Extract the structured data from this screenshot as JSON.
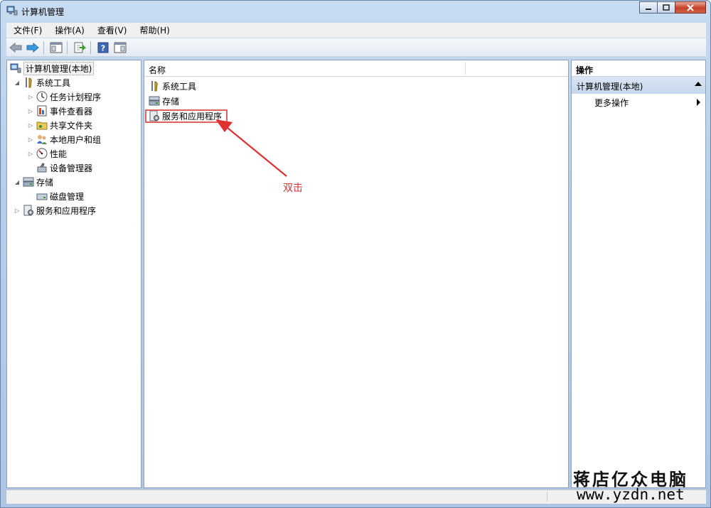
{
  "window": {
    "title": "计算机管理"
  },
  "menu": [
    "文件(F)",
    "操作(A)",
    "查看(V)",
    "帮助(H)"
  ],
  "toolbar": {
    "icons": [
      "back-arrow-icon",
      "forward-arrow-icon",
      "show-console-tree-icon",
      "export-list-icon",
      "help-icon",
      "show-action-pane-icon"
    ]
  },
  "tree": {
    "root": "计算机管理(本地)",
    "system_tools": "系统工具",
    "task_scheduler": "任务计划程序",
    "event_viewer": "事件查看器",
    "shared_folders": "共享文件夹",
    "local_users": "本地用户和组",
    "performance": "性能",
    "device_manager": "设备管理器",
    "storage": "存储",
    "disk_management": "磁盘管理",
    "services_apps": "服务和应用程序"
  },
  "list": {
    "column_name": "名称",
    "items": [
      "系统工具",
      "存储",
      "服务和应用程序"
    ]
  },
  "actions": {
    "header": "操作",
    "group": "计算机管理(本地)",
    "more": "更多操作"
  },
  "annotation": {
    "text": "双击",
    "color": "#e03030"
  },
  "watermark": {
    "line1": "蒋店亿众电脑",
    "line2": "www.yzdn.net"
  }
}
